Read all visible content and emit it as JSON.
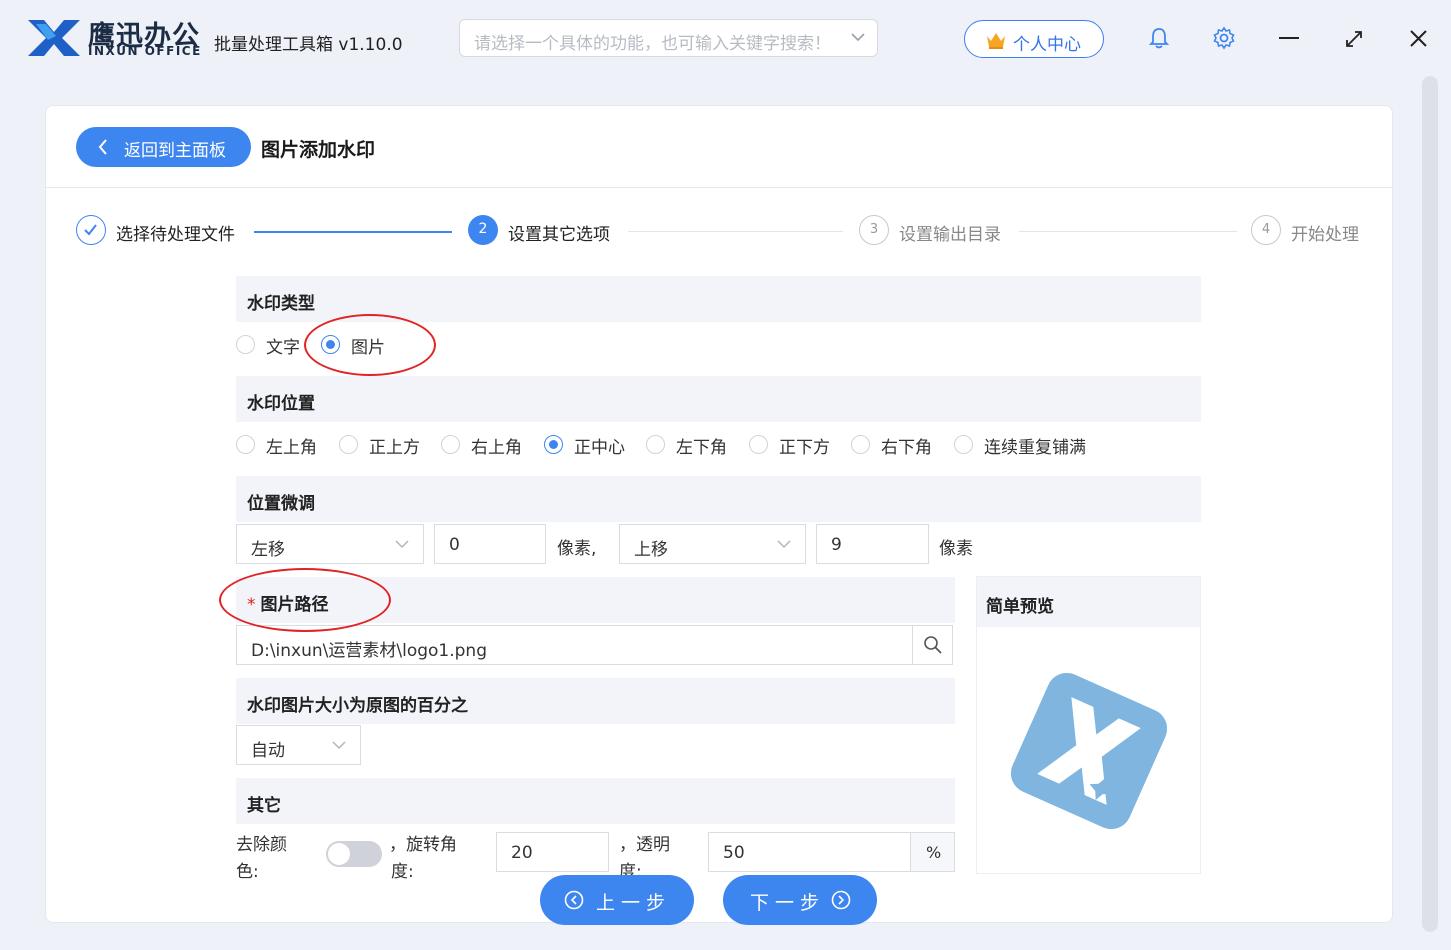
{
  "titlebar": {
    "brand_cn": "鹰迅办公",
    "brand_en": "INXUN OFFICE",
    "app_title": "批量处理工具箱 v1.10.0",
    "search_placeholder": "请选择一个具体的功能，也可输入关键字搜索！",
    "user_center": "个人中心",
    "icons": [
      "bell-icon",
      "gear-icon",
      "minimize-icon",
      "maximize-icon",
      "close-icon"
    ]
  },
  "header": {
    "back_label": "返回到主面板",
    "page_title": "图片添加水印"
  },
  "steps": [
    {
      "num": "1",
      "label": "选择待处理文件",
      "state": "done"
    },
    {
      "num": "2",
      "label": "设置其它选项",
      "state": "active"
    },
    {
      "num": "3",
      "label": "设置输出目录",
      "state": "pending"
    },
    {
      "num": "4",
      "label": "开始处理",
      "state": "pending"
    }
  ],
  "watermark_type": {
    "title": "水印类型",
    "options": [
      "文字",
      "图片"
    ],
    "selected": "图片"
  },
  "watermark_position": {
    "title": "水印位置",
    "options": [
      "左上角",
      "正上方",
      "右上角",
      "正中心",
      "左下角",
      "正下方",
      "右下角",
      "连续重复铺满"
    ],
    "selected": "正中心"
  },
  "fine_tune": {
    "title": "位置微调",
    "h_direction": "左移",
    "h_value": "0",
    "h_unit": "像素,",
    "v_direction": "上移",
    "v_value": "9",
    "v_unit": "像素"
  },
  "image_path": {
    "required_mark": "*",
    "title": "图片路径",
    "value": "D:\\inxun\\运营素材\\logo1.png"
  },
  "size": {
    "title": "水印图片大小为原图的百分之",
    "value": "自动"
  },
  "other": {
    "title": "其它",
    "remove_color_label_1": "去除颜",
    "remove_color_label_2": "色:",
    "remove_color_on": false,
    "rotate_label_1": "，旋转角",
    "rotate_label_2": "度:",
    "rotate_value": "20",
    "opacity_label_1": "，透明",
    "opacity_label_2": "度:",
    "opacity_value": "50",
    "opacity_unit": "%"
  },
  "preview": {
    "title": "简单预览"
  },
  "nav": {
    "prev": "上一步",
    "next": "下一步"
  },
  "colors": {
    "accent": "#3e86ef",
    "annotation": "#e02424",
    "preview_logo": "#7fb5de"
  }
}
